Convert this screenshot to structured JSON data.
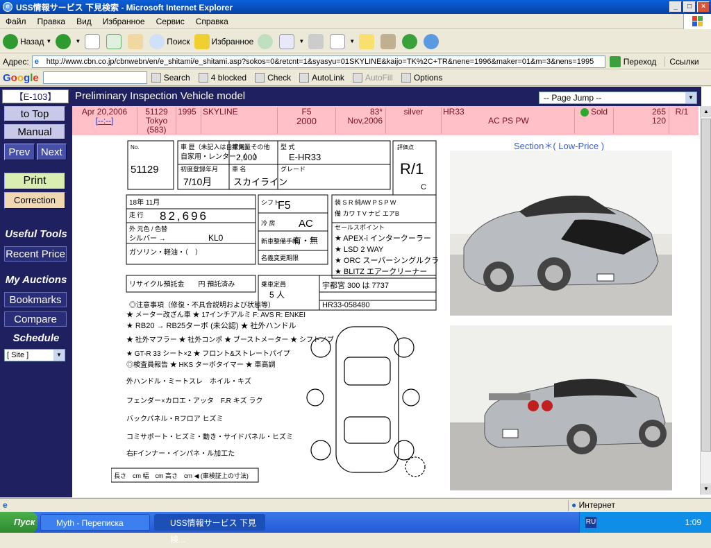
{
  "window": {
    "title": "USS情報サービス 下見検索 - Microsoft Internet Explorer"
  },
  "menu": [
    "Файл",
    "Правка",
    "Вид",
    "Избранное",
    "Сервис",
    "Справка"
  ],
  "toolbar": {
    "back": "Назад",
    "search": "Поиск",
    "favorites": "Избранное"
  },
  "address": {
    "label": "Адрес:",
    "url": "http://www.cbn.co.jp/cbnwebn/en/e_shitami/e_shitami.asp?sokos=0&retcnt=1&syasyu=01SKYLINE&kaijo=TK%2C+TR&nene=1996&maker=01&m=3&nens=1995",
    "go": "Переход",
    "links": "Ссылки"
  },
  "googlebar": {
    "logo": "Google",
    "search": "Search",
    "blocked": "4 blocked",
    "check": "Check",
    "autolink": "AutoLink",
    "autofill": "AutoFill",
    "options": "Options"
  },
  "nav": {
    "badge": "【E-103】",
    "to_top": "to Top",
    "manual": "Manual",
    "prev": "Prev",
    "next": "Next",
    "print": "Print",
    "correction": "Correction",
    "useful_tools": "Useful Tools",
    "recent_price": "Recent Price",
    "my_auctions": "My Auctions",
    "bookmarks": "Bookmarks",
    "compare": "Compare",
    "schedule": "Schedule",
    "site": "[ Site ]"
  },
  "header": {
    "title": "Preliminary Inspection Vehicle model",
    "page_jump": "-- Page Jump --"
  },
  "lot": {
    "date": "Apr 20,2006",
    "link": "[--:--]",
    "lot_no": "51129",
    "site": "Tokyo",
    "site_code": "(583)",
    "year": "1995",
    "model": "SKYLINE",
    "trans": "F5",
    "cc": "2000",
    "mileage": "83*",
    "reg_date": "Nov,2006",
    "color": "silver",
    "type": "HR33",
    "equipment": "AC PS PW",
    "status": "Sold",
    "price_1": "265",
    "price_2": "120",
    "grade": "R/1"
  },
  "section_label": "Section＊( Low-Price )",
  "sheet": {
    "no": "51129",
    "kcode": "E-HR33",
    "grade_mark": "R/1",
    "grade_sub": "C",
    "chassis": "HR33-058480",
    "plate": "宇都宮 300 は 7737",
    "year_label": "18年 11月",
    "mileage": "82,696",
    "trans": "F5",
    "ac": "AC",
    "color_code": "KL0",
    "shift": "シフト",
    "selling_points": [
      "★ APEX-i インタークーラー",
      "★ LSD 2 WAY",
      "★ ORC スーパーシングルクラッチ",
      "★ BLITZ エアークリーナー"
    ],
    "notes": [
      "★ メーター改ざん車 ★ 17インチアルミ F: AVS R: ENKEI",
      "★ RB20 → RB25ターボ (未公認) ★ 社外ハンドル",
      "★ 社外マフラー ★ 社外コンポ ★ ブーストメーター ★ シフトノブ",
      "★ GT-R 33 シート×2 ★ フロント&ストレートパイプ"
    ],
    "inspector_label": "◎検査員報告 ★ HKS ターボタイマー ★ 車高調"
  },
  "status_bar": {
    "zone": "Интернет"
  },
  "taskbar": {
    "start": "Пуск",
    "task1": "Myth - Переписка",
    "task2": "USS情報サービス 下見検...",
    "lang": "RU",
    "clock": "1:09"
  }
}
